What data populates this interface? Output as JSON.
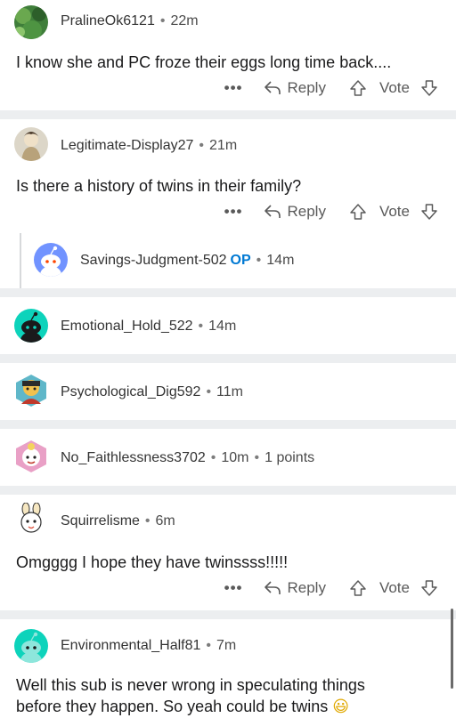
{
  "comments": [
    {
      "user": "PralineOk6121",
      "time": "22m",
      "body": "I know she and PC froze their eggs long time back....",
      "actions": {
        "more": "•••",
        "reply": "Reply",
        "vote": "Vote"
      }
    },
    {
      "user": "Legitimate-Display27",
      "time": "21m",
      "body": "Is there a history of twins in their family?",
      "actions": {
        "more": "•••",
        "reply": "Reply",
        "vote": "Vote"
      }
    },
    {
      "user": "Savings-Judgment-502",
      "op": "OP",
      "time": "14m"
    },
    {
      "user": "Emotional_Hold_522",
      "time": "14m"
    },
    {
      "user": "Psychological_Dig592",
      "time": "11m"
    },
    {
      "user": "No_Faithlessness3702",
      "time": "10m",
      "points": "1 points"
    },
    {
      "user": "Squirrelisme",
      "time": "6m",
      "body": "Omgggg I hope they have twinssss!!!!!",
      "actions": {
        "more": "•••",
        "reply": "Reply",
        "vote": "Vote"
      }
    },
    {
      "user": "Environmental_Half81",
      "time": "7m",
      "body_line1": "Well this sub is never wrong in speculating things",
      "body_line2": "before they happen. So yeah could be twins",
      "emoji": "😃"
    }
  ],
  "separator": "•",
  "colors": {
    "op": "#0079d3",
    "divider": "#eceef0",
    "snoo_blue": "#7193ff",
    "snoo_teal": "#0dd3bb"
  },
  "icons": [
    "reply-arrow-icon",
    "upvote-arrow-icon",
    "downvote-arrow-icon"
  ]
}
